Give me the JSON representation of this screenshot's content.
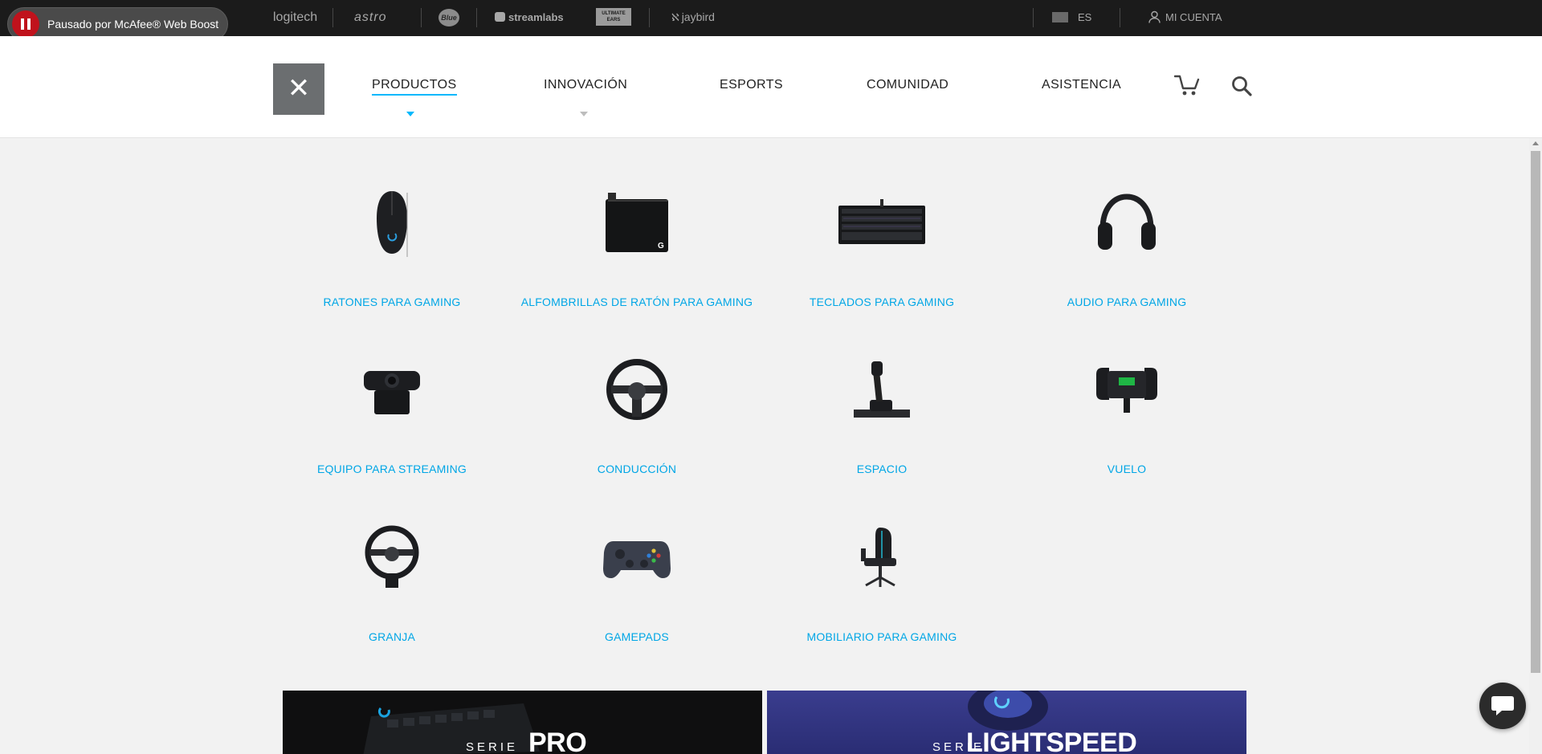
{
  "mcafee": {
    "label": "Pausado por McAfee® Web Boost"
  },
  "brandbar": {
    "brands": {
      "logitech": "logitech",
      "astro": "astro",
      "blue": "Blue",
      "streamlabs": "streamlabs",
      "ultimate_ears": "ULTIMATE EARS",
      "jaybird": "jaybird"
    },
    "language": "ES",
    "account": "MI CUENTA"
  },
  "nav": {
    "items": [
      "PRODUCTOS",
      "INNOVACIÓN",
      "ESPORTS",
      "COMUNIDAD",
      "ASISTENCIA"
    ],
    "active": "PRODUCTOS",
    "accent_color": "#00b8fc"
  },
  "categories": [
    {
      "label": "RATONES PARA GAMING",
      "icon": "gaming-mouse"
    },
    {
      "label": "ALFOMBRILLAS DE RATÓN PARA GAMING",
      "icon": "mouse-pad"
    },
    {
      "label": "TECLADOS PARA GAMING",
      "icon": "keyboard"
    },
    {
      "label": "AUDIO PARA GAMING",
      "icon": "headset"
    },
    {
      "label": "EQUIPO PARA STREAMING",
      "icon": "webcam"
    },
    {
      "label": "CONDUCCIÓN",
      "icon": "steering-wheel"
    },
    {
      "label": "ESPACIO",
      "icon": "flight-joystick"
    },
    {
      "label": "VUELO",
      "icon": "flight-yoke"
    },
    {
      "label": "GRANJA",
      "icon": "farm-wheel"
    },
    {
      "label": "GAMEPADS",
      "icon": "gamepad"
    },
    {
      "label": "MOBILIARIO PARA GAMING",
      "icon": "gaming-chair"
    }
  ],
  "category_link_color": "#00a6e6",
  "banners": [
    {
      "serie": "SERIE",
      "name": "PRO"
    },
    {
      "serie": "SERIE",
      "name": "LIGHTSPEED"
    }
  ]
}
